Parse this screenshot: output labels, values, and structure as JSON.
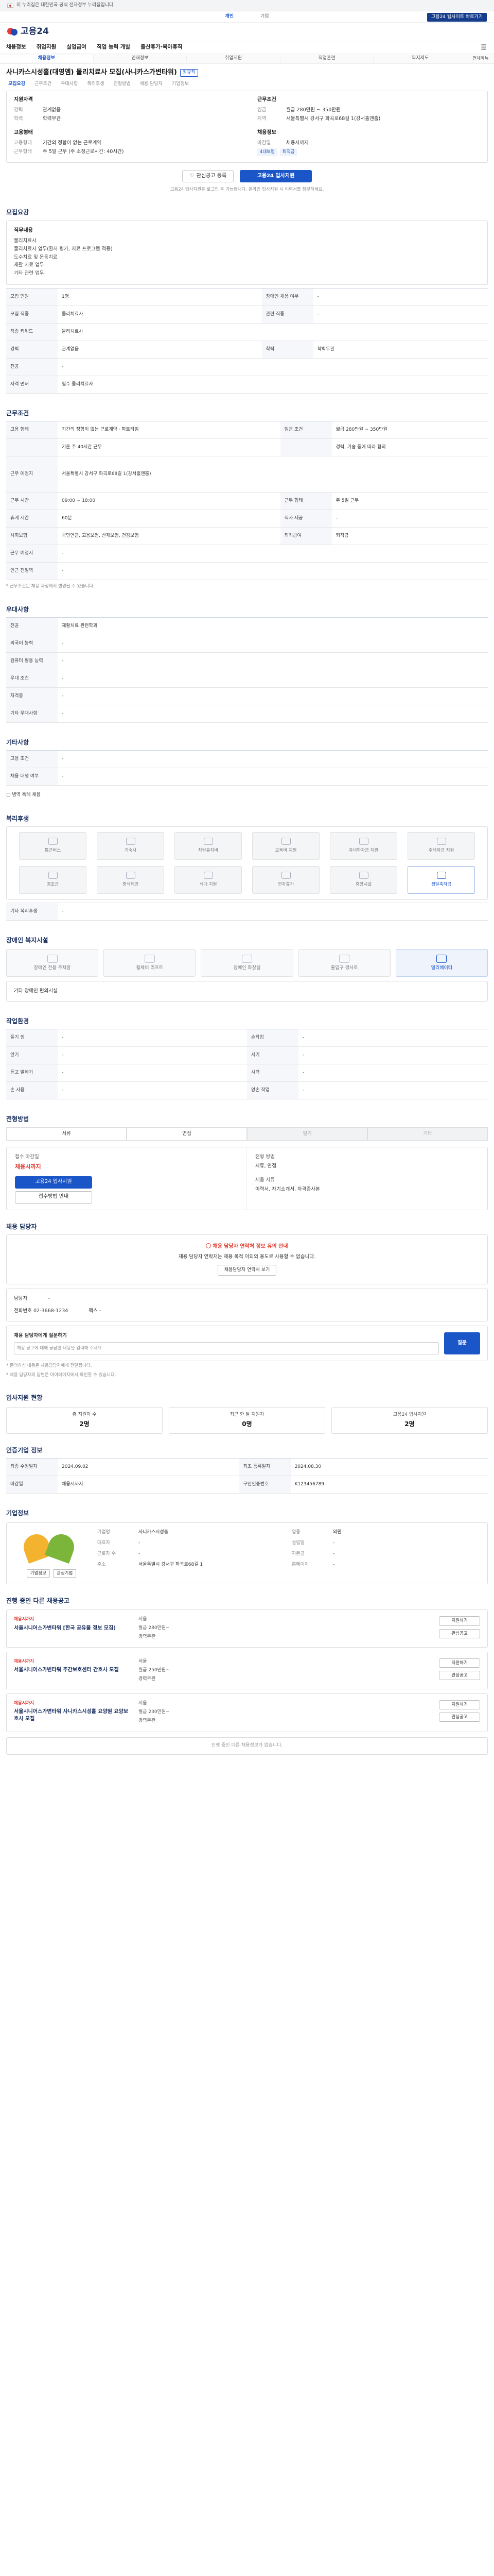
{
  "gov_bar": {
    "text": "이 누리집은 대한민국 공식 전자정부 누리집입니다."
  },
  "top_links": {
    "items": [
      "개인",
      "기업"
    ],
    "right": "고용24 웹사이트 바로가기"
  },
  "header": {
    "logo": "고용24"
  },
  "gnb": {
    "items": [
      "채용정보",
      "취업지원",
      "실업급여",
      "직업 능력 개발",
      "출산휴가·육아휴직"
    ]
  },
  "subnav": {
    "items": [
      "채용정보",
      "인재정보",
      "취업지원",
      "직업훈련",
      "복지제도"
    ],
    "small": "전체메뉴"
  },
  "posting": {
    "title": "사니카스시성홀(대영엠) 물리치료사 모집(사니카스가변타워)",
    "badge": "정규직",
    "tabs": [
      "모집요강",
      "근무조건",
      "우대사항",
      "복리후생",
      "전형방법",
      "채용 담당자",
      "기업정보"
    ]
  },
  "summary": {
    "h1": "지원자격",
    "rows1": [
      {
        "k": "경력",
        "v": "관계없음"
      },
      {
        "k": "학력",
        "v": "학력무관"
      }
    ],
    "h2": "근무조건",
    "rows2": [
      {
        "k": "임금",
        "v": "월급 280만원 ~ 350만원"
      },
      {
        "k": "지역",
        "v": "서울특별시 강서구 화곡로68길 1(강서홀앤홈)"
      }
    ],
    "h3": "고용형태",
    "rows3": [
      {
        "k": "고용형태",
        "v": "기간의 정함이 없는 근로계약"
      },
      {
        "k": "근무형태",
        "v": "주 5일 근무 (주 소정근로시간: 40시간)"
      }
    ],
    "h4": "채용정보",
    "rows4": [
      {
        "k": "마감일",
        "v": "채용시까지"
      }
    ],
    "tags": [
      "4대보험",
      "퇴직금"
    ]
  },
  "actions": {
    "scrap": "관심공고 등록",
    "apply": "고용24 입사지원",
    "note": "고용24 입사지원은 로그인 후 가능합니다. 온라인 입사지원 시 이력서를 첨부하세요."
  },
  "s1": {
    "title": "모집요강",
    "box_title": "직무내용",
    "lines": [
      "물리치료사",
      "물리치료사 업무(환자 평가, 치료 프로그램 적용)",
      "도수치료 및 운동치료",
      "재활 치료 업무",
      "기타 관련 업무"
    ],
    "rows": [
      [
        "모집 인원",
        "1명",
        "장애인 채용 여부",
        "-"
      ],
      [
        "모집 직종",
        "물리치료사",
        "관련 직종",
        "-"
      ],
      [
        "직종 키워드",
        "물리치료사",
        "",
        ""
      ],
      [
        "경력",
        "관계없음",
        "학력",
        "학력무관"
      ],
      [
        "전공",
        "-",
        "",
        ""
      ],
      [
        "자격 면허",
        "필수  물리치료사",
        "",
        ""
      ]
    ]
  },
  "s2": {
    "title": "근무조건",
    "rows": [
      [
        "고용 형태",
        "기간의 정함이 없는 근로계약 · 파트타임",
        "임금 조건",
        "월급 280만원 ~ 350만원"
      ],
      [
        "",
        "기준 주 40시간 근무",
        "",
        "경력, 기술 등에 따라 협의"
      ],
      [
        "근무 예정지",
        "서울특별시 강서구 화곡로68길 1(강서홀앤홈)",
        "",
        ""
      ],
      [
        "근무 시간",
        "09:00 ~ 18:00",
        "근무 형태",
        "주 5일 근무"
      ],
      [
        "휴게 시간",
        "60분",
        "식사 제공",
        "-"
      ],
      [
        "사회보험",
        "국민연금, 고용보험, 산재보험, 건강보험",
        "퇴직급여",
        "퇴직금"
      ],
      [
        "근무 예정지",
        "-",
        "",
        ""
      ],
      [
        "인근 전철역",
        "-",
        "",
        ""
      ]
    ],
    "note": "* 근무조건은 채용 과정에서 변경될 수 있습니다."
  },
  "s3": {
    "title": "우대사항",
    "rows": [
      [
        "전공",
        "재활치료 관련학과"
      ],
      [
        "외국어 능력",
        "-"
      ],
      [
        "컴퓨터 활용 능력",
        "-"
      ],
      [
        "우대 조건",
        "-"
      ],
      [
        "자격증",
        "-"
      ],
      [
        "기타 우대사항",
        "-"
      ]
    ]
  },
  "s4": {
    "title": "기타사항",
    "rows": [
      [
        "고용 조건",
        "-"
      ],
      [
        "채용 대행 여부",
        "-"
      ]
    ],
    "chk": "□ 병역 특례 채용"
  },
  "s5": {
    "title": "복리후생",
    "items": [
      "통근버스",
      "기숙사",
      "차량유지비",
      "교육비 지원",
      "자녀학자금 지원",
      "주택자금 지원",
      "경조금",
      "중식제공",
      "식대 지원",
      "연차휴가",
      "휴양시설",
      "생일축하금"
    ],
    "active_index": 11,
    "other_label": "기타 복리후생",
    "other_value": "-"
  },
  "s6": {
    "title": "장애인 복지시설",
    "items": [
      "장애인 전용 주차장",
      "휠체어 리프트",
      "장애인 화장실",
      "출입구 경사로",
      "엘리베이터"
    ],
    "active_index": 4,
    "other": "기타 장애인 편의시설"
  },
  "s7": {
    "title": "작업환경",
    "rows": [
      [
        "들기 힘",
        "-",
        "손작업",
        "-"
      ],
      [
        "앉기",
        "-",
        "서기",
        "-"
      ],
      [
        "듣고 말하기",
        "-",
        "시력",
        "-"
      ],
      [
        "손 사용",
        "-",
        "양손 작업",
        "-"
      ]
    ]
  },
  "s8": {
    "title": "전형방법",
    "steps": [
      "서류",
      "면접",
      "필기",
      "기타"
    ],
    "apply_label": "접수 마감일",
    "apply_date": "채용시까지",
    "btn1": "고용24 입사지원",
    "btn2": "접수방법 안내",
    "method_label": "전형 방법",
    "method_value": "서류, 면접",
    "docs_label": "제출 서류",
    "docs_value": "이력서, 자기소개서, 자격증사본"
  },
  "s9": {
    "title": "채용 담당자",
    "warn_head": "채용 담당자 연락처 정보 유의 안내",
    "warn_text": "채용 담당자 연락처는 채용 목적 이외의 용도로 사용할 수 없습니다.",
    "warn_btn": "채용담당자 연락처 보기",
    "dept_label": "담당자",
    "dept_value": "-",
    "phone_label": "전화번호",
    "phone_value": "02-3668-1234",
    "fax_label": "팩스",
    "fax_value": "-",
    "inquiry_title": "채용 담당자에게 질문하기",
    "inquiry_placeholder": "채용 공고에 대해 궁금한 내용을 입력해 주세요.",
    "inquiry_btn": "질문",
    "notes": [
      "* 문의하신 내용은 채용담당자에게 전달됩니다.",
      "* 채용 담당자의 답변은 마이페이지에서 확인할 수 있습니다."
    ]
  },
  "s10": {
    "title": "입사지원 현황",
    "stats": [
      {
        "label": "총 지원자 수",
        "value": "2명"
      },
      {
        "label": "최근 한 달 지원자",
        "value": "0명"
      },
      {
        "label": "고용24 입사지원",
        "value": "2명"
      }
    ]
  },
  "s11": {
    "title": "인증기업 정보",
    "rows": [
      [
        "최종 수정일자",
        "2024.09.02",
        "최초 등록일자",
        "2024.08.30"
      ],
      [
        "마감일",
        "채용시까지",
        "구인인증번호",
        "K123456789"
      ]
    ]
  },
  "s12": {
    "title": "기업정보",
    "logo_btns": [
      "기업정보",
      "관심기업"
    ],
    "rows": [
      [
        "기업명",
        "사니카스시성홀",
        "업종",
        "의원"
      ],
      [
        "대표자",
        "-",
        "설립일",
        "-"
      ],
      [
        "근로자 수",
        "-",
        "자본금",
        "-"
      ],
      [
        "주소",
        "서울특별시 강서구 화곡로68길 1",
        "홈페이지",
        "-"
      ]
    ]
  },
  "s13": {
    "title": "진행 중인 다른 채용공고",
    "items": [
      {
        "tag": "채용시까지",
        "name": "서울시니어스가변타워 [한국 공유물 정보 모집]",
        "meta": [
          "서울",
          "월급 280만원~",
          "경력무관"
        ],
        "btns": [
          "지원하기",
          "관심공고"
        ]
      },
      {
        "tag": "채용시까지",
        "name": "서울시니어스가변타워 주간보호센터 간호사 모집",
        "meta": [
          "서울",
          "월급 250만원~",
          "경력무관"
        ],
        "btns": [
          "지원하기",
          "관심공고"
        ]
      },
      {
        "tag": "채용시까지",
        "name": "서울시니어스가변타워 사니카스시성홀 요양원 요양보호사 모집",
        "meta": [
          "서울",
          "월급 230만원~",
          "경력무관"
        ],
        "btns": [
          "지원하기",
          "관심공고"
        ]
      }
    ],
    "footer": "진행 중인 다른 채용정보가 없습니다."
  }
}
